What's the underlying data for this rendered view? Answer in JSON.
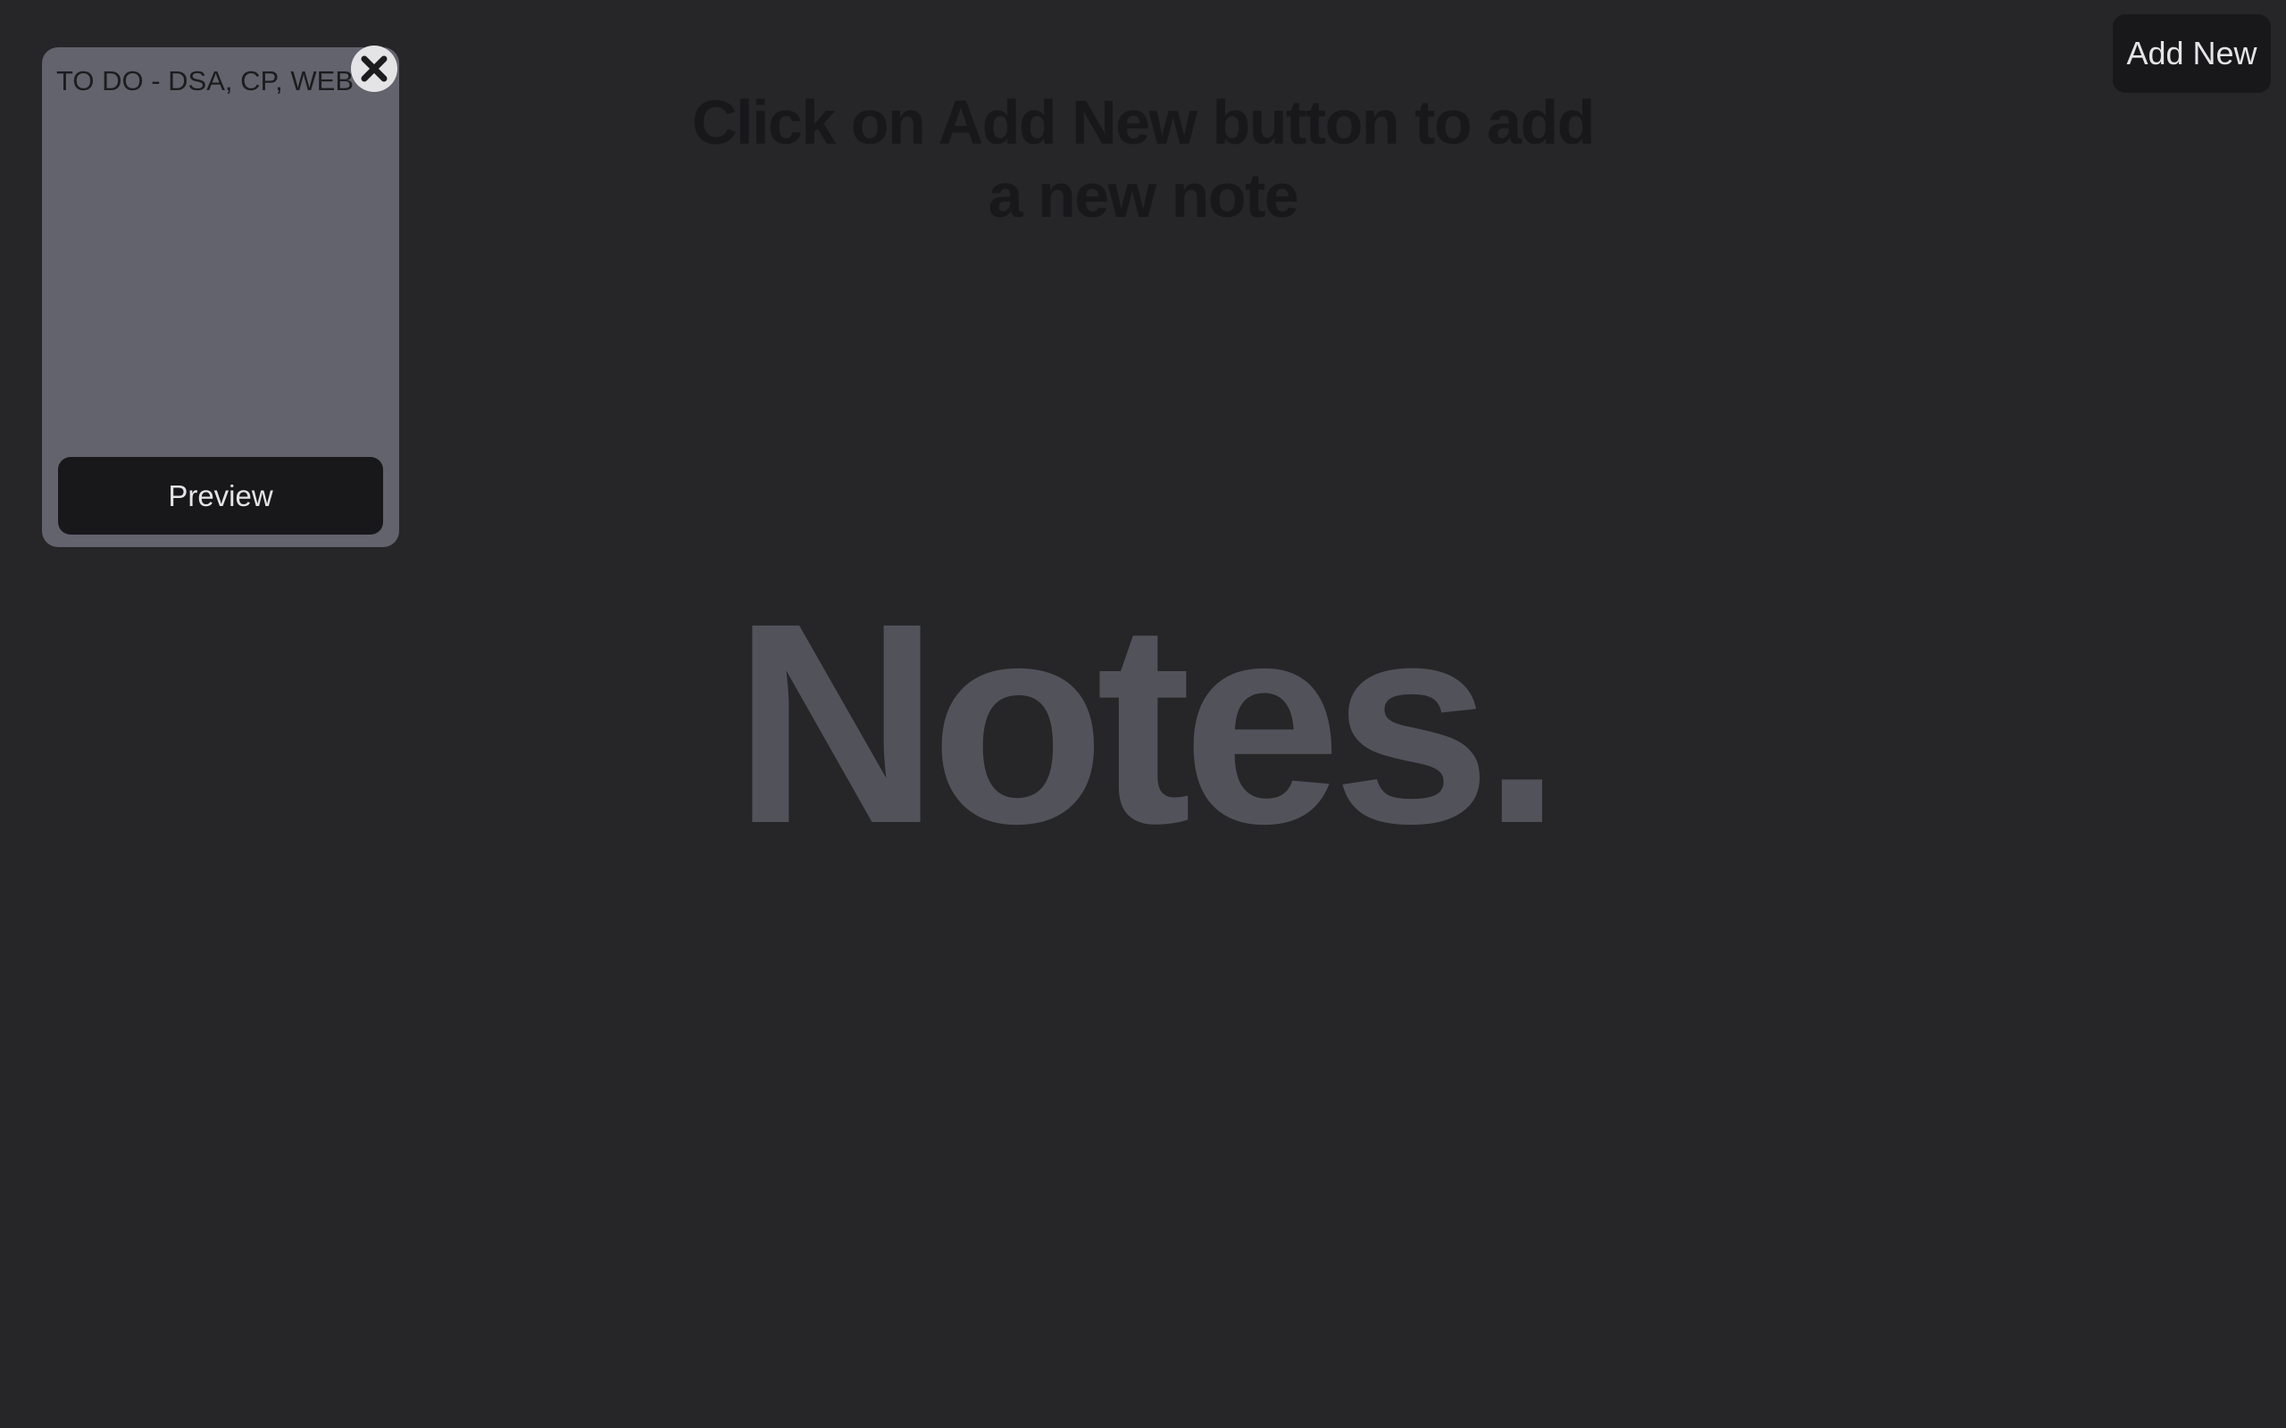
{
  "header": {
    "add_new_label": "Add New"
  },
  "main": {
    "hint_line1": "Click on Add New button to add",
    "hint_line2": "a new note",
    "watermark": "Notes."
  },
  "notes": [
    {
      "text": "TO DO - DSA, CP, WEB",
      "preview_label": "Preview",
      "close_icon": "close-icon"
    }
  ],
  "colors": {
    "background": "#262628",
    "card": "#63636d",
    "button": "#18181b",
    "watermark": "#52525b"
  }
}
